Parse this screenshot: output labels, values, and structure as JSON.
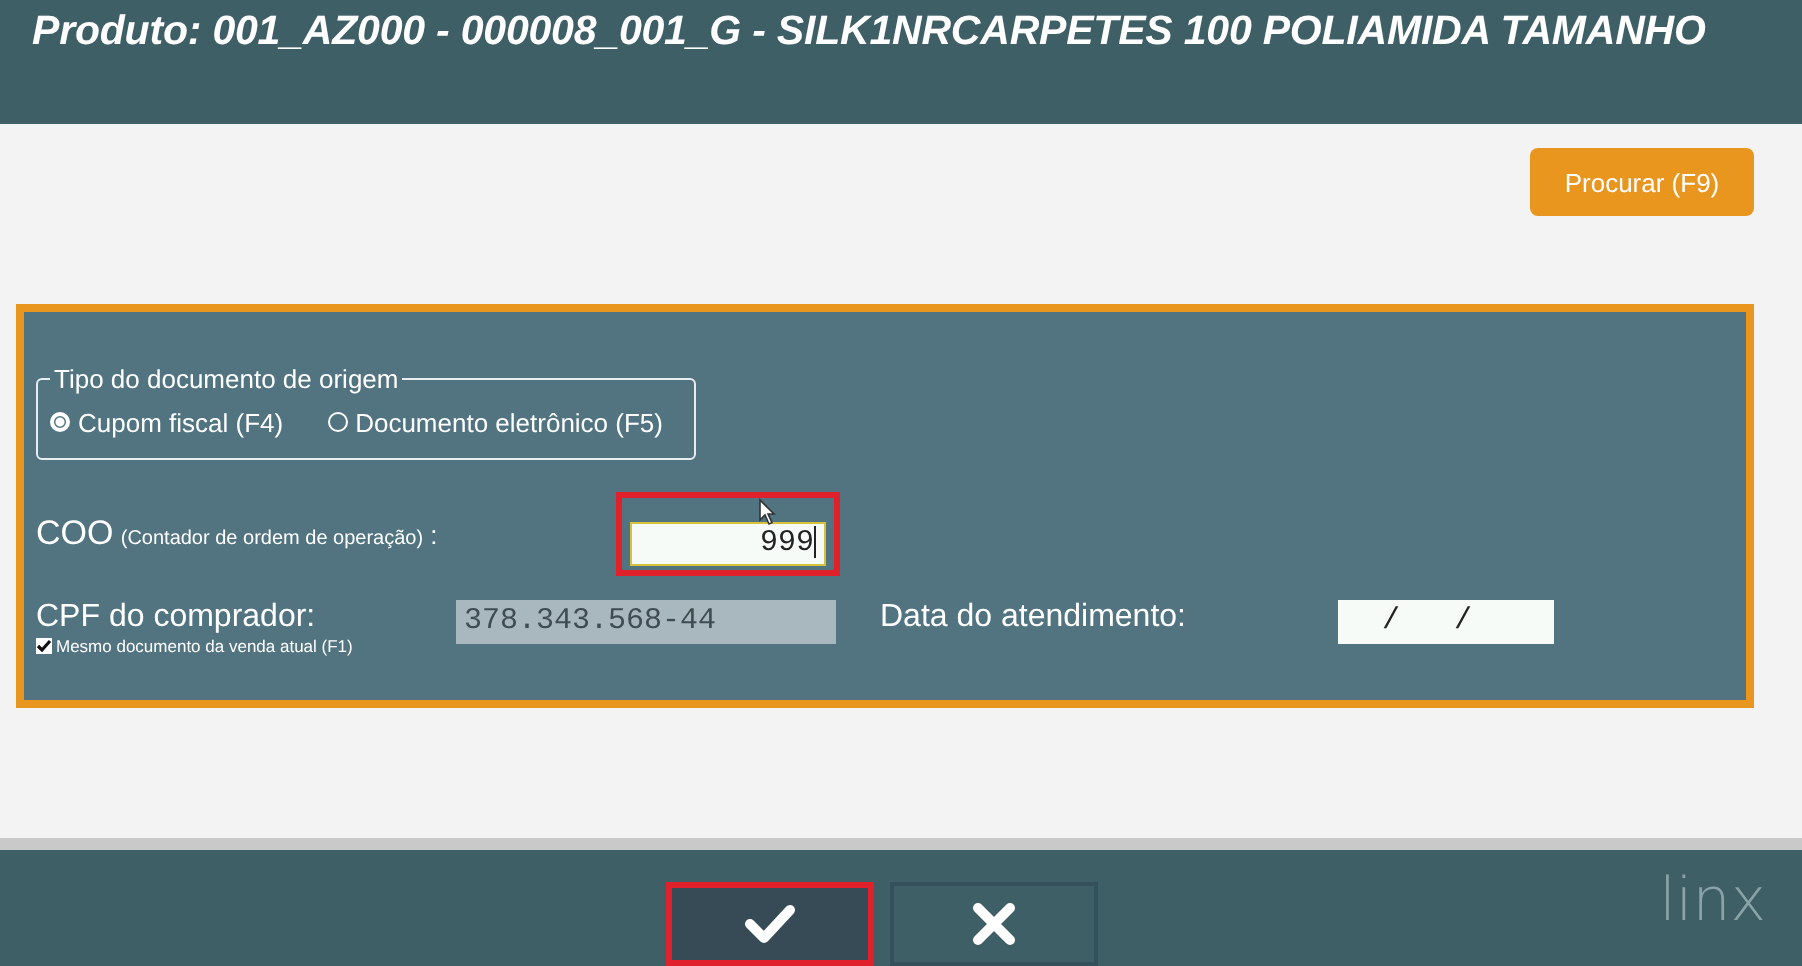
{
  "header": {
    "title": "Produto:  001_AZ000 - 000008_001_G - SILK1NRCARPETES 100 POLIAMIDA TAMANHO"
  },
  "search_button": {
    "label": "Procurar (F9)"
  },
  "origin_document": {
    "legend": "Tipo do documento de origem",
    "options": [
      {
        "label": "Cupom fiscal (F4)",
        "selected": true
      },
      {
        "label": "Documento eletrônico (F5)",
        "selected": false
      }
    ]
  },
  "coo": {
    "label": "COO",
    "hint": "(Contador de ordem de operação)",
    "colon": ":",
    "value": "999",
    "highlighted": true
  },
  "cpf": {
    "label": "CPF do comprador:",
    "value": "378.343.568-44",
    "same_document": {
      "label": "Mesmo documento da venda atual (F1)",
      "checked": true
    }
  },
  "date": {
    "label": "Data do atendimento:",
    "value": "  /   /"
  },
  "actions": [
    {
      "kind": "confirm",
      "highlighted": true
    },
    {
      "kind": "cancel",
      "highlighted": false
    }
  ],
  "brand": "linx"
}
